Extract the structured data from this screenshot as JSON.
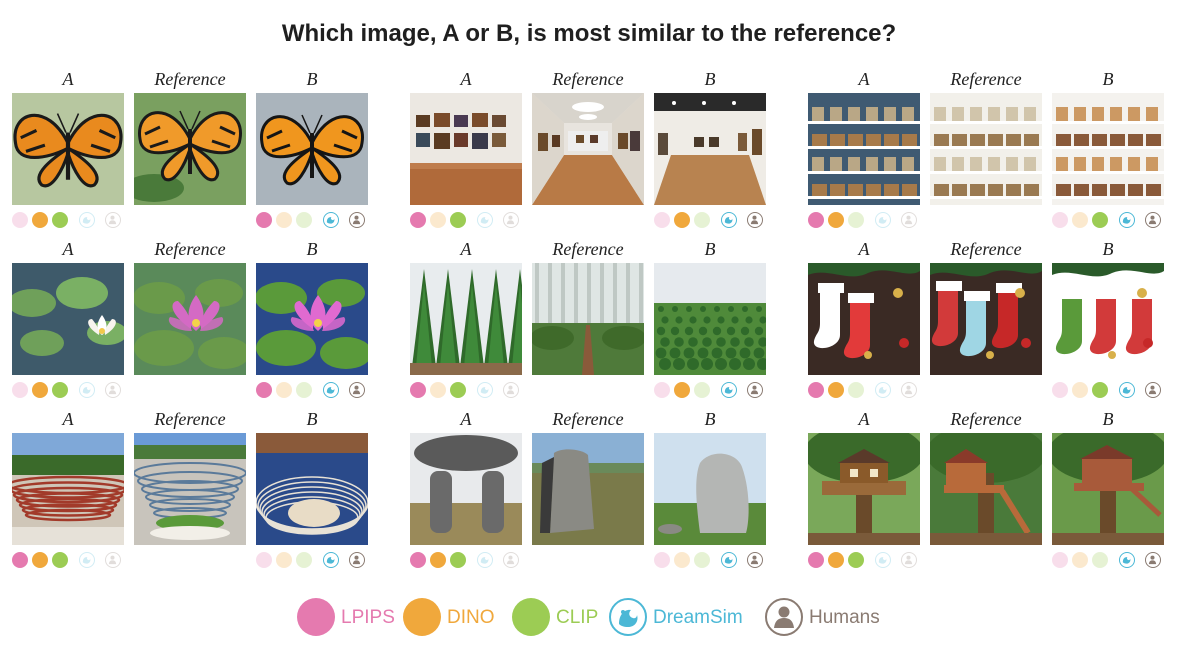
{
  "title": "Which image, A or B, is most similar to the reference?",
  "column_labels": {
    "a": "A",
    "reference": "Reference",
    "b": "B"
  },
  "metrics": [
    {
      "key": "lpips",
      "label": "LPIPS",
      "color": "#e57aaf"
    },
    {
      "key": "dino",
      "label": "DINO",
      "color": "#f0a83c"
    },
    {
      "key": "clip",
      "label": "CLIP",
      "color": "#9ccc54"
    },
    {
      "key": "dreamsim",
      "label": "DreamSim",
      "color": "#4cb8d6"
    },
    {
      "key": "humans",
      "label": "Humans",
      "color": "#8a7b72"
    }
  ],
  "examples": [
    {
      "subject": "butterfly",
      "votes": {
        "lpips": "B",
        "dino": "A",
        "clip": "A",
        "dreamsim": "B",
        "humans": "B"
      }
    },
    {
      "subject": "art gallery",
      "votes": {
        "lpips": "A",
        "dino": "B",
        "clip": "A",
        "dreamsim": "B",
        "humans": "B"
      }
    },
    {
      "subject": "pantry shelves",
      "votes": {
        "lpips": "A",
        "dino": "A",
        "clip": "B",
        "dreamsim": "B",
        "humans": "B"
      }
    },
    {
      "subject": "lotus",
      "votes": {
        "lpips": "B",
        "dino": "A",
        "clip": "A",
        "dreamsim": "B",
        "humans": "B"
      }
    },
    {
      "subject": "tree nursery",
      "votes": {
        "lpips": "A",
        "dino": "B",
        "clip": "A",
        "dreamsim": "B",
        "humans": "B"
      }
    },
    {
      "subject": "christmas stockings",
      "votes": {
        "lpips": "A",
        "dino": "A",
        "clip": "B",
        "dreamsim": "B",
        "humans": "B"
      }
    },
    {
      "subject": "amphitheater",
      "votes": {
        "lpips": "A",
        "dino": "A",
        "clip": "A",
        "dreamsim": "B",
        "humans": "B"
      }
    },
    {
      "subject": "standing stones",
      "votes": {
        "lpips": "A",
        "dino": "A",
        "clip": "A",
        "dreamsim": "B",
        "humans": "B"
      }
    },
    {
      "subject": "treehouse",
      "votes": {
        "lpips": "A",
        "dino": "A",
        "clip": "A",
        "dreamsim": "B",
        "humans": "B"
      }
    }
  ]
}
